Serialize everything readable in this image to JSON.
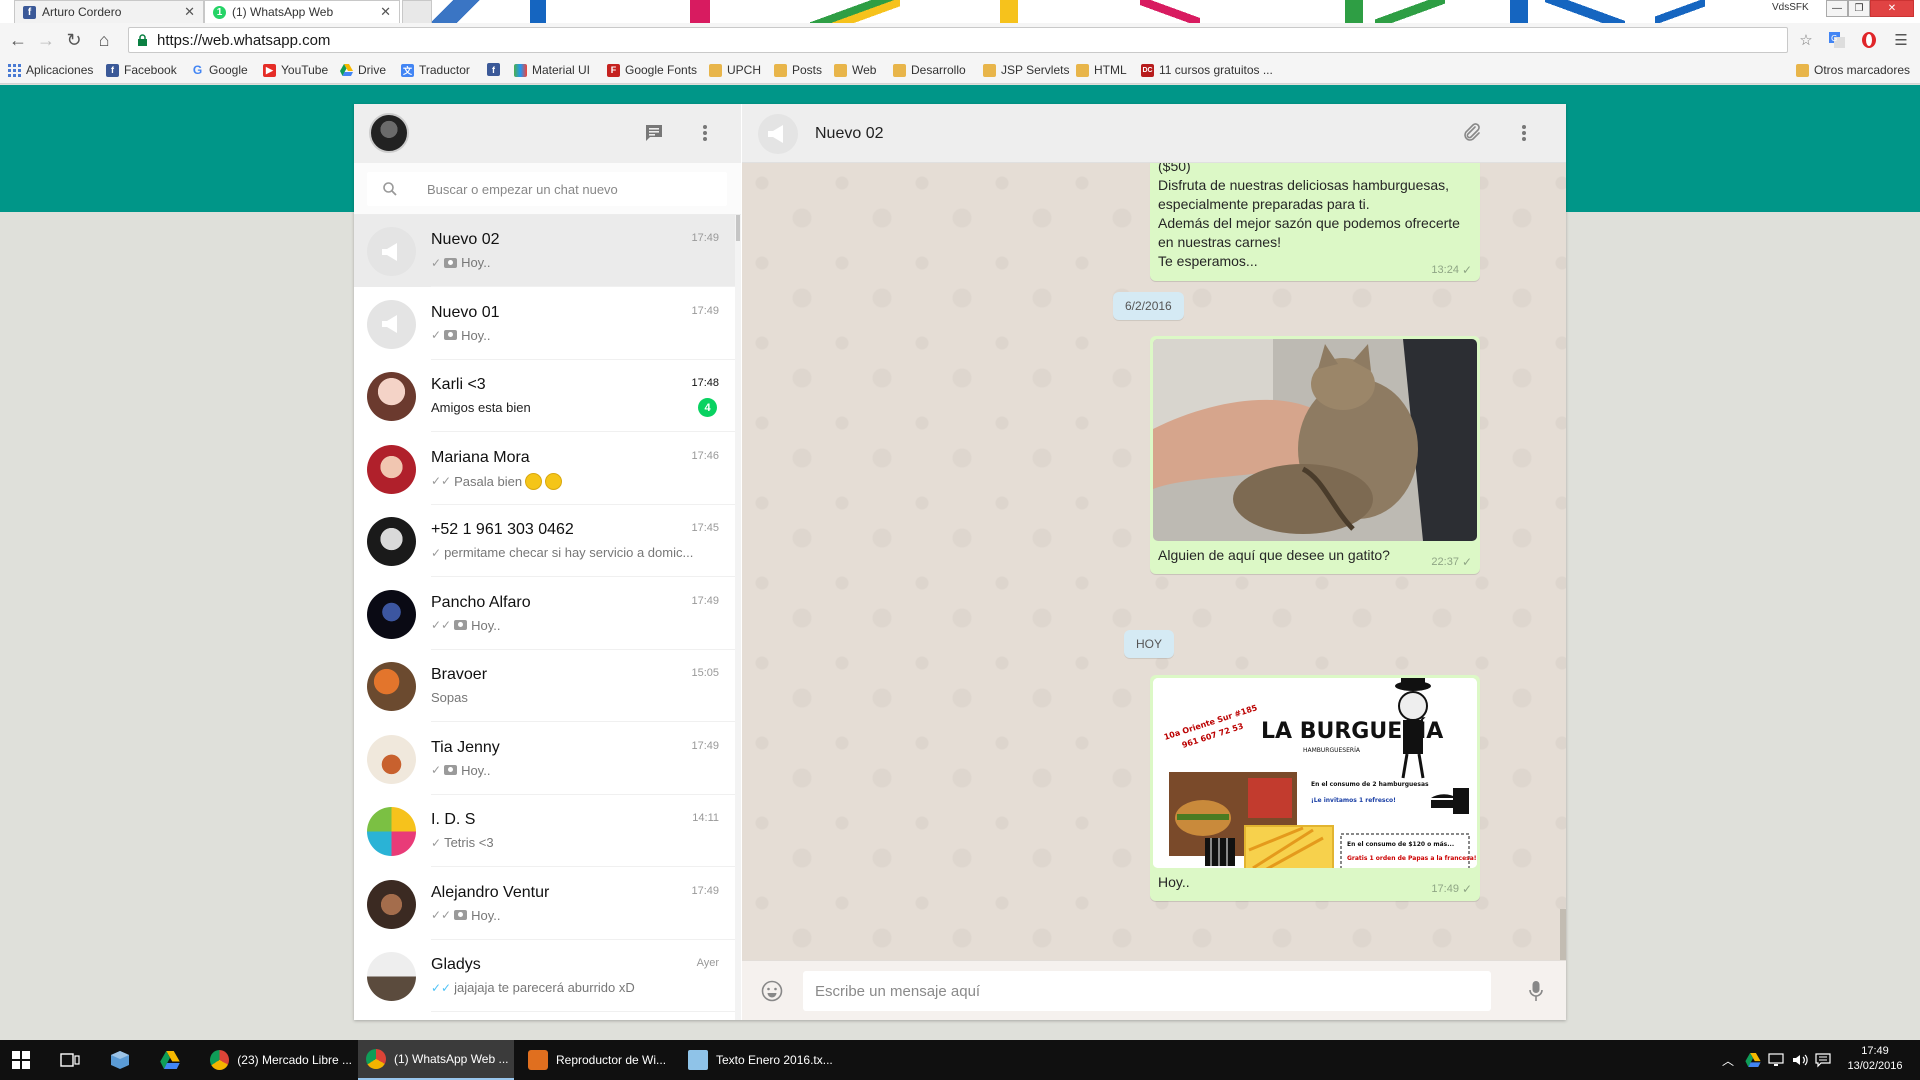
{
  "browser": {
    "tabs": [
      {
        "title": "Arturo Cordero",
        "favicon": "facebook-icon"
      },
      {
        "title": "(1) WhatsApp Web",
        "favicon": "whatsapp-icon"
      }
    ],
    "window_label": "VdsSFK",
    "url": "https://web.whatsapp.com",
    "bookmarks": [
      {
        "label": "Aplicaciones",
        "icon": "apps-grid-icon"
      },
      {
        "label": "Facebook",
        "icon": "facebook-icon"
      },
      {
        "label": "Google",
        "icon": "google-icon"
      },
      {
        "label": "YouTube",
        "icon": "youtube-icon"
      },
      {
        "label": "Drive",
        "icon": "drive-icon"
      },
      {
        "label": "Traductor",
        "icon": "translate-icon"
      },
      {
        "label": "",
        "icon": "facebook-icon"
      },
      {
        "label": "Material UI",
        "icon": "material-ui-icon"
      },
      {
        "label": "Google Fonts",
        "icon": "google-fonts-icon"
      },
      {
        "label": "UPCH",
        "icon": "folder-icon"
      },
      {
        "label": "Posts",
        "icon": "folder-icon"
      },
      {
        "label": "Web",
        "icon": "folder-icon"
      },
      {
        "label": "Desarrollo",
        "icon": "folder-icon"
      },
      {
        "label": "JSP Servlets",
        "icon": "folder-icon"
      },
      {
        "label": "HTML",
        "icon": "folder-icon"
      },
      {
        "label": "11 cursos gratuitos ...",
        "icon": "devcode-icon"
      }
    ],
    "other_bookmarks": "Otros marcadores"
  },
  "whatsapp": {
    "search": {
      "placeholder": "Buscar o empezar un chat nuevo"
    },
    "chats": [
      {
        "name": "Nuevo 02",
        "time": "17:49",
        "preview": "Hoy..",
        "ticks": "single",
        "photo": true,
        "avatar": "group",
        "selected": true
      },
      {
        "name": "Nuevo 01",
        "time": "17:49",
        "preview": "Hoy..",
        "ticks": "single",
        "photo": true,
        "avatar": "group"
      },
      {
        "name": "Karli <3",
        "time": "17:48",
        "preview": "Amigos esta bien",
        "unread": "4",
        "avatar": "photo-pink"
      },
      {
        "name": "Mariana Mora",
        "time": "17:46",
        "preview": "Pasala bien",
        "ticks": "double",
        "emoji": true,
        "avatar": "photo-red"
      },
      {
        "name": "+52 1 961 303 0462",
        "time": "17:45",
        "preview": "permitame checar si hay servicio a domic...",
        "ticks": "single",
        "avatar": "photo-bw"
      },
      {
        "name": "Pancho Alfaro",
        "time": "17:49",
        "preview": "Hoy..",
        "ticks": "double",
        "photo": true,
        "avatar": "photo-dark"
      },
      {
        "name": "Bravoer",
        "time": "15:05",
        "preview": "Sopas",
        "avatar": "photo-orange"
      },
      {
        "name": "Tia Jenny",
        "time": "17:49",
        "preview": "Hoy..",
        "ticks": "single",
        "photo": true,
        "avatar": "photo-food"
      },
      {
        "name": "I. D. S",
        "time": "14:11",
        "preview": "Tetris <3",
        "ticks": "single",
        "avatar": "photo-yellow"
      },
      {
        "name": "Alejandro Ventur",
        "time": "17:49",
        "preview": "Hoy..",
        "ticks": "double",
        "photo": true,
        "avatar": "photo-group"
      },
      {
        "name": "Gladys",
        "time": "Ayer",
        "preview": "jajajaja te parecerá aburrido xD",
        "ticks": "double-blue",
        "avatar": "photo-girl"
      }
    ],
    "conversation": {
      "name": "Nuevo 02",
      "messages": [
        {
          "type": "text",
          "text": "($50)\nDisfruta de nuestras deliciosas hamburguesas,\nespecialmente preparadas para ti.\nAdemás del mejor sazón que podemos ofrecerte\nen nuestras carnes!\nTe esperamos...",
          "time": "13:24"
        },
        {
          "type": "date",
          "text": "6/2/2016"
        },
        {
          "type": "image",
          "image": "kitten-photo",
          "caption": "Alguien de aquí que desee un gatito?",
          "time": "22:37"
        },
        {
          "type": "date",
          "text": "HOY"
        },
        {
          "type": "image",
          "image": "burger-flyer",
          "caption": "Hoy..",
          "time": "17:49"
        }
      ],
      "flyer": {
        "brand": "LA BURGUESÍA",
        "tagline": "HAMBURGUESERÍA",
        "address": "10a Oriente Sur #185",
        "phone": "961 607 72 53",
        "promo1": "En el consumo de 2 hamburguesas",
        "promo1b": "¡Le invitamos 1 refresco!",
        "promo2": "En el consumo de $120 o más...",
        "promo2b": "Gratis 1 orden de Papas a la francesa!"
      },
      "composer_placeholder": "Escribe un mensaje aquí"
    }
  },
  "taskbar": {
    "apps": [
      {
        "label": "(23) Mercado Libre ...",
        "icon": "chrome-icon"
      },
      {
        "label": "(1) WhatsApp Web ...",
        "icon": "chrome-icon",
        "active": true
      },
      {
        "label": "Reproductor de Wi...",
        "icon": "media-player-icon"
      },
      {
        "label": "Texto Enero 2016.tx...",
        "icon": "notepad-icon"
      }
    ],
    "time": "17:49",
    "date": "13/02/2016"
  },
  "colors": {
    "whatsapp_teal": "#009688",
    "bubble_out": "#dcf8c6",
    "chat_bg": "#e5ddd5",
    "unread_badge": "#09d261",
    "date_chip": "#d5eaf4"
  }
}
